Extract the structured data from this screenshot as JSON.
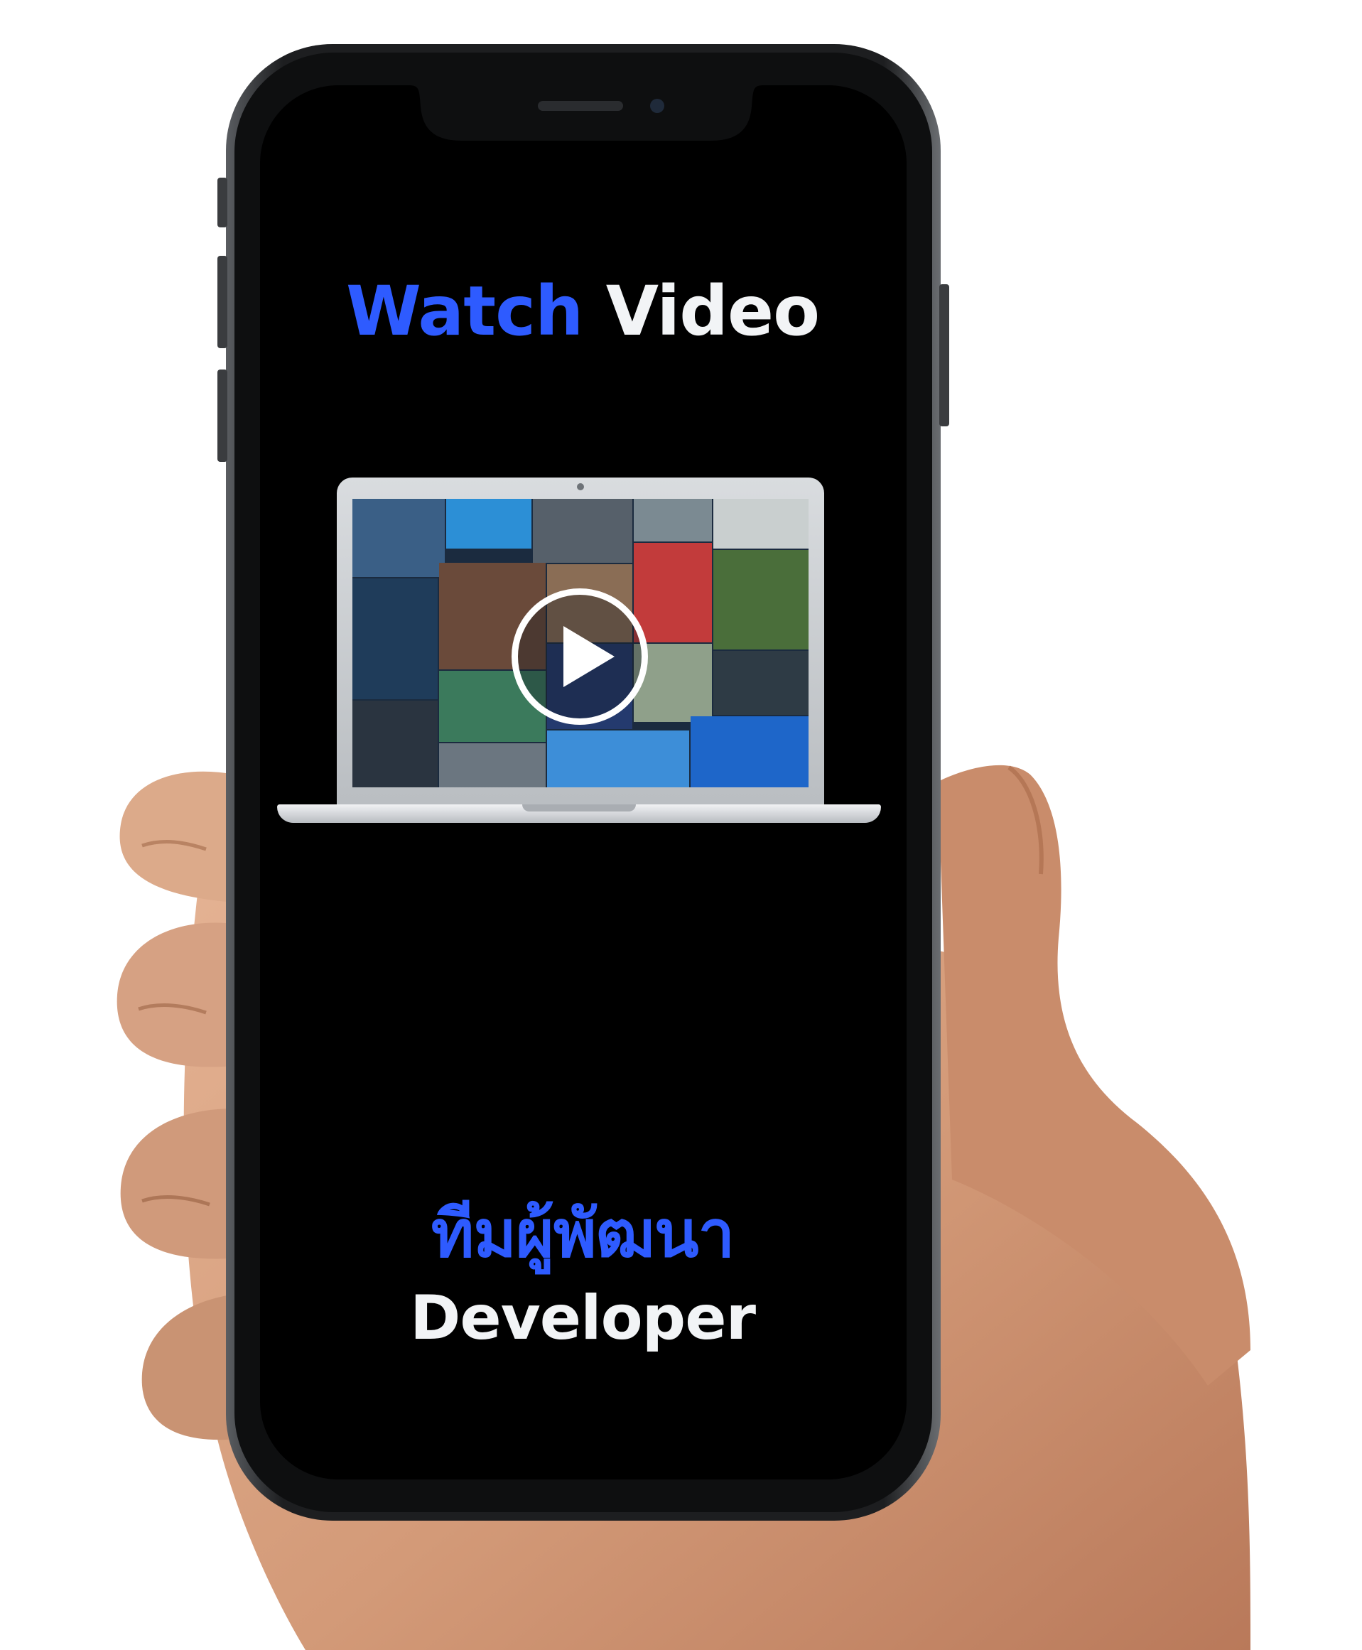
{
  "screen": {
    "headline_accent": "Watch",
    "headline_plain": "Video",
    "thai_title": "ทีมผู้พัฒนา",
    "subtitle": "Developer"
  },
  "video": {
    "play_icon": "play-icon"
  },
  "colors": {
    "accent": "#2e5bff",
    "text_light": "#f2f4f6",
    "screen_background": "#000000",
    "skin": "#d19a7b"
  }
}
